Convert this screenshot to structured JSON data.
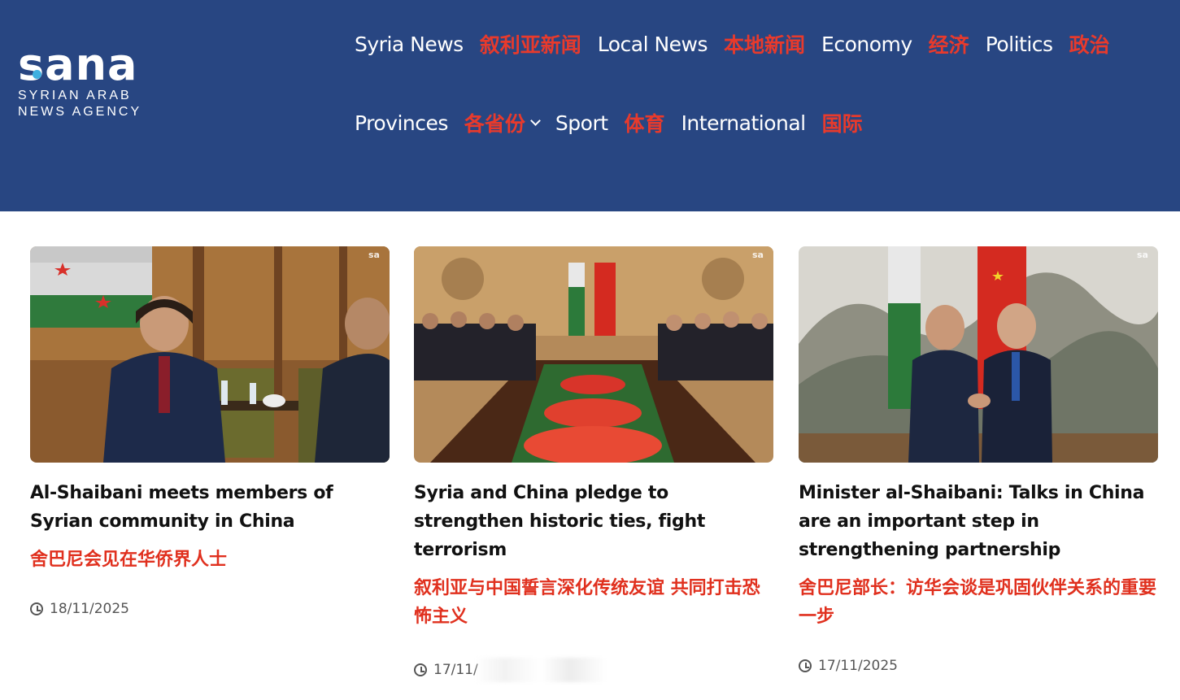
{
  "header": {
    "logo": {
      "wordmark": "sana",
      "line1": "SYRIAN ARAB",
      "line2": "NEWS AGENCY"
    },
    "nav_row1": [
      {
        "en": "Syria News",
        "zh": "叙利亚新闻"
      },
      {
        "en": "Local News",
        "zh": "本地新闻"
      },
      {
        "en": "Economy",
        "zh": "经济"
      },
      {
        "en": "Politics",
        "zh": "政治"
      }
    ],
    "nav_row2": [
      {
        "en": "Provinces",
        "zh": "各省份",
        "has_dropdown": true
      },
      {
        "en": "Sport",
        "zh": "体育"
      },
      {
        "en": "International",
        "zh": "国际"
      }
    ]
  },
  "articles": [
    {
      "title_en": "Al-Shaibani meets members of Syrian community in China",
      "title_zh": "舍巴尼会见在华侨界人士",
      "date": "18/11/2025",
      "watermark": "sa"
    },
    {
      "title_en": "Syria and China pledge to strengthen historic ties, fight terrorism",
      "title_zh": "叙利亚与中国誓言深化传统友谊 共同打击恐怖主义",
      "date": "17/11/",
      "watermark": "sa"
    },
    {
      "title_en": "Minister al-Shaibani: Talks in China are an important step in strengthening partnership",
      "title_zh": "舍巴尼部长：访华会谈是巩固伙伴关系的重要一步",
      "date": "17/11/2025",
      "watermark": "sa"
    }
  ],
  "colors": {
    "header_bg": "#284682",
    "accent_red": "#e0301e",
    "logo_dot": "#3fb0e0"
  }
}
